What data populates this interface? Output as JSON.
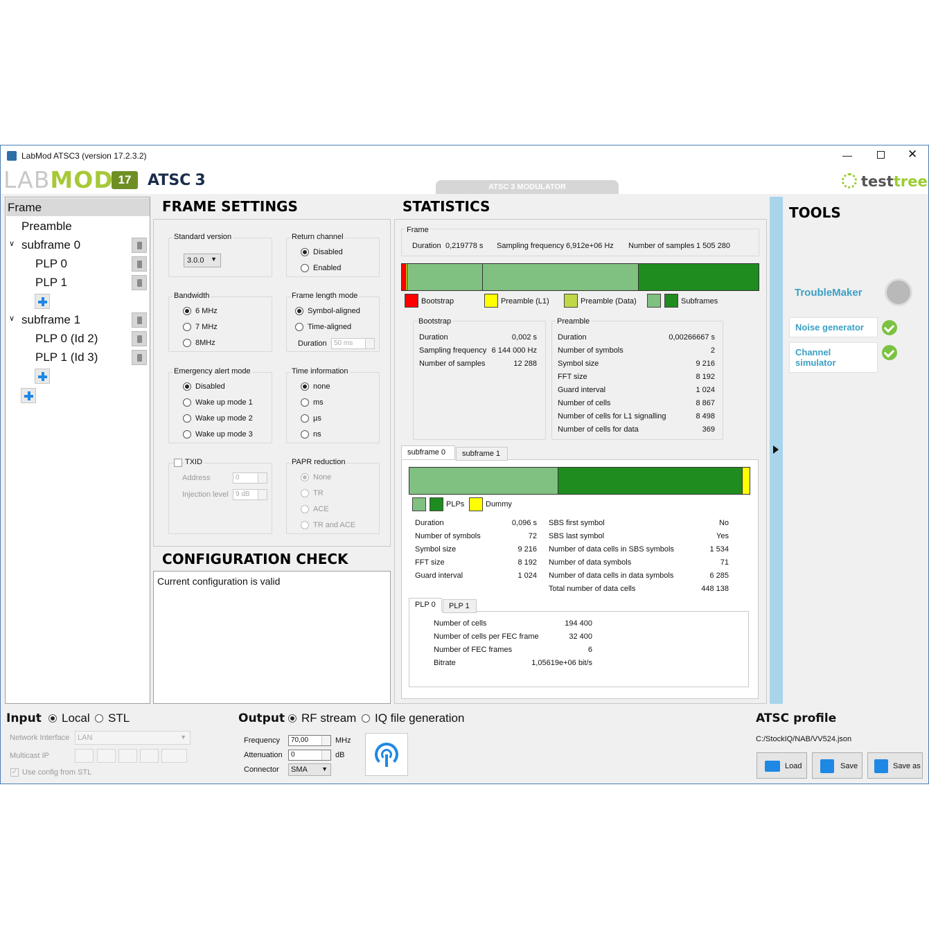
{
  "window": {
    "title": "LabMod ATSC3 (version 17.2.3.2)"
  },
  "banner": {
    "logo_lab": "LAB",
    "logo_mod": "MOD",
    "badge": "17",
    "atsc": "ATSC",
    "atsc_num": "3",
    "center_tab": "ATSC 3 MODULATOR",
    "brand_test": "test",
    "brand_tree": "tree"
  },
  "tree": {
    "frame": "Frame",
    "preamble": "Preamble",
    "subframe0": "subframe 0",
    "sf0_plp0": "PLP 0",
    "sf0_plp1": "PLP 1",
    "subframe1": "subframe 1",
    "sf1_plp0": "PLP 0 (Id 2)",
    "sf1_plp1": "PLP 1 (Id 3)"
  },
  "frame_settings": {
    "title": "FRAME SETTINGS",
    "standard_version": {
      "label": "Standard version",
      "value": "3.0.0"
    },
    "return_channel": {
      "label": "Return channel",
      "options": [
        "Disabled",
        "Enabled"
      ],
      "selected": "Disabled"
    },
    "bandwidth": {
      "label": "Bandwidth",
      "options": [
        "6 MHz",
        "7 MHz",
        "8MHz"
      ],
      "selected": "6 MHz"
    },
    "frame_length": {
      "label": "Frame length mode",
      "options": [
        "Symbol-aligned",
        "Time-aligned"
      ],
      "selected": "Symbol-aligned",
      "duration_label": "Duration",
      "duration_value": "50 ms"
    },
    "emergency": {
      "label": "Emergency alert mode",
      "options": [
        "Disabled",
        "Wake up mode 1",
        "Wake up mode 2",
        "Wake up mode 3"
      ],
      "selected": "Disabled"
    },
    "time_info": {
      "label": "Time information",
      "options": [
        "none",
        "ms",
        "µs",
        "ns"
      ],
      "selected": "none"
    },
    "txid": {
      "label": "TXID",
      "address_label": "Address",
      "address_value": "0",
      "injection_label": "Injection level",
      "injection_value": "9 dB"
    },
    "papr": {
      "label": "PAPR reduction",
      "options": [
        "None",
        "TR",
        "ACE",
        "TR and ACE"
      ],
      "selected": "None"
    }
  },
  "config_check": {
    "title": "CONFIGURATION CHECK",
    "message": "Current configuration is valid"
  },
  "statistics": {
    "title": "STATISTICS",
    "frame": {
      "label": "Frame",
      "duration_label": "Duration",
      "duration": "0,219778 s",
      "sampling_label": "Sampling frequency",
      "sampling": "6,912e+06 Hz",
      "samples_label": "Number of samples",
      "samples": "1 505 280"
    },
    "frame_bar": {
      "bootstrap": 0.009,
      "preamble_l1": 0.004,
      "preamble_data": 0.212,
      "subframe0": 0.437,
      "subframe1": 0.338
    },
    "legend": {
      "bootstrap": "Bootstrap",
      "preamble_l1": "Preamble (L1)",
      "preamble_data": "Preamble (Data)",
      "subframes": "Subframes"
    },
    "colors": {
      "bootstrap": "#ff0000",
      "preamble_l1": "#ffff00",
      "preamble_data": "#c0d848",
      "subframe_light": "#80c080",
      "subframe_dark": "#1e8c1e",
      "dummy": "#ffff00"
    },
    "bootstrap": {
      "label": "Bootstrap",
      "rows": [
        [
          "Duration",
          "0,002 s"
        ],
        [
          "Sampling frequency",
          "6 144 000 Hz"
        ],
        [
          "Number of samples",
          "12 288"
        ]
      ]
    },
    "preamble": {
      "label": "Preamble",
      "rows": [
        [
          "Duration",
          "0,00266667 s"
        ],
        [
          "Number of symbols",
          "2"
        ],
        [
          "Symbol size",
          "9 216"
        ],
        [
          "FFT size",
          "8 192"
        ],
        [
          "Guard interval",
          "1 024"
        ],
        [
          "Number of cells",
          "8 867"
        ],
        [
          "Number of cells for L1 signalling",
          "8 498"
        ],
        [
          "Number of cells for data",
          "369"
        ]
      ]
    },
    "subframe_tabs": [
      "subframe 0",
      "subframe 1"
    ],
    "subframe_bar": {
      "plp0": 0.442,
      "plp1": 0.55,
      "dummy": 0.022
    },
    "subframe_legend": {
      "plps": "PLPs",
      "dummy": "Dummy"
    },
    "subframe_left": [
      [
        "Duration",
        "0,096 s"
      ],
      [
        "Number of symbols",
        "72"
      ],
      [
        "Symbol size",
        "9 216"
      ],
      [
        "FFT size",
        "8 192"
      ],
      [
        "Guard interval",
        "1 024"
      ]
    ],
    "subframe_right": [
      [
        "SBS first symbol",
        "No"
      ],
      [
        "SBS last symbol",
        "Yes"
      ],
      [
        "Number of data cells in SBS symbols",
        "1 534"
      ],
      [
        "Number of data symbols",
        "71"
      ],
      [
        "Number of data cells in data symbols",
        "6 285"
      ],
      [
        "Total number of data cells",
        "448 138"
      ]
    ],
    "plp_tabs": [
      "PLP 0",
      "PLP 1"
    ],
    "plp": [
      [
        "Number of cells",
        "194 400"
      ],
      [
        "Number of cells per FEC frame",
        "32 400"
      ],
      [
        "Number of FEC frames",
        "6"
      ],
      [
        "Bitrate",
        "1,05619e+06  bit/s"
      ]
    ]
  },
  "tools": {
    "title": "TOOLS",
    "troublemaker": "TroubleMaker",
    "noise": "Noise generator",
    "channel": "Channel simulator"
  },
  "input": {
    "title": "Input",
    "options": [
      "Local",
      "STL"
    ],
    "selected": "Local",
    "network_label": "Network Interface",
    "network_value": "LAN",
    "multicast_label": "Multicast IP",
    "use_config": "Use config from STL"
  },
  "output": {
    "title": "Output",
    "options": [
      "RF stream",
      "IQ file generation"
    ],
    "selected": "RF stream",
    "frequency_label": "Frequency",
    "frequency_value": "70,00",
    "frequency_unit": "MHz",
    "attenuation_label": "Attenuation",
    "attenuation_value": "0",
    "attenuation_unit": "dB",
    "connector_label": "Connector",
    "connector_value": "SMA"
  },
  "profile": {
    "title": "ATSC profile",
    "path": "C:/StockIQ/NAB/VV524.json",
    "load": "Load",
    "save": "Save",
    "save_as": "Save as"
  }
}
